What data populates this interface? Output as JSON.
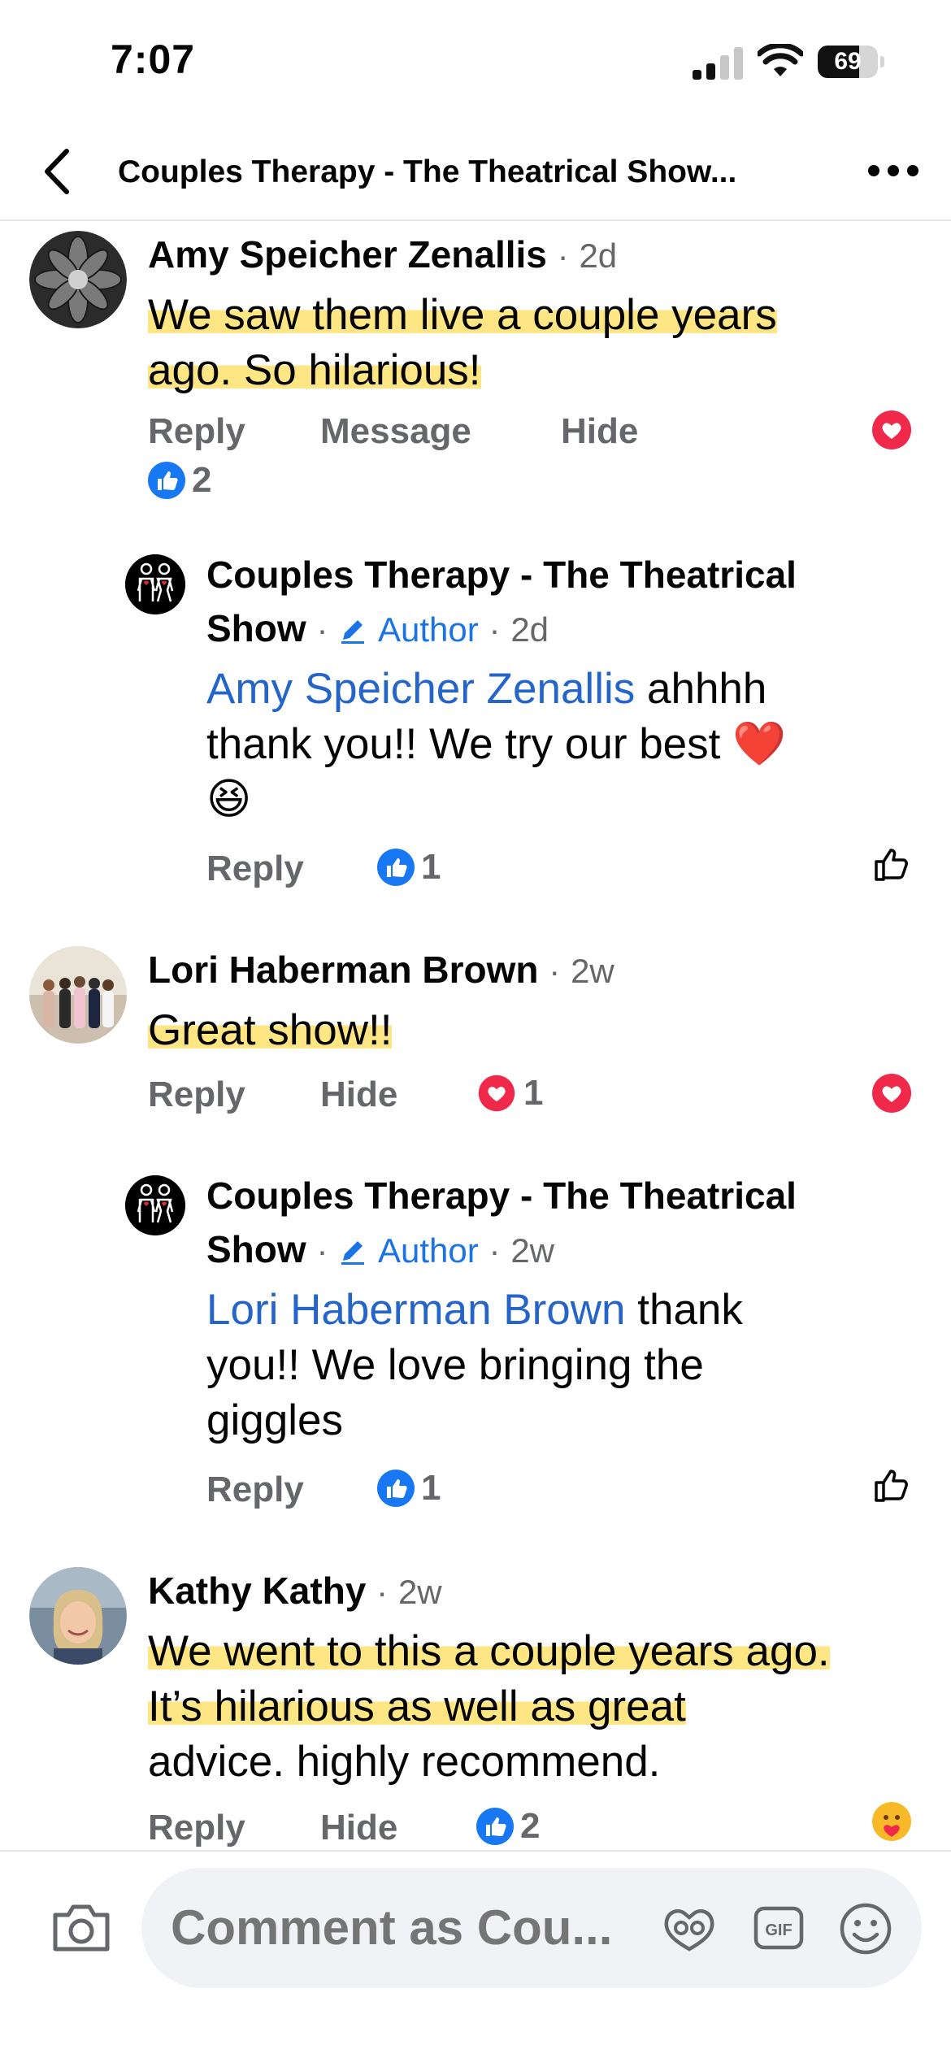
{
  "status_bar": {
    "time": "7:07",
    "battery": "69",
    "battery_level": 0.69
  },
  "header": {
    "title": "Couples Therapy - The Theatrical Show..."
  },
  "comments": [
    {
      "author": "Amy Speicher Zenallis",
      "time": "2d",
      "text_line1": "We saw them live a couple years",
      "text_line2": "ago.  So hilarious!",
      "actions": [
        "Reply",
        "Message",
        "Hide"
      ],
      "reaction_count": "2",
      "reaction_type": "like"
    },
    {
      "author_line1": "Couples Therapy - The Theatrical",
      "author_line2": "Show",
      "badge": "Author",
      "time": "2d",
      "mention": "Amy Speicher Zenallis",
      "text_rest": " ahhhh",
      "text_line2": "thank you!! We try our best",
      "emoji_heart": "❤️",
      "emoji_laugh": "😆",
      "actions": [
        "Reply"
      ],
      "reaction_count": "1",
      "reaction_type": "like"
    },
    {
      "author": "Lori Haberman Brown",
      "time": "2w",
      "text_line1": "Great show!!",
      "actions": [
        "Reply",
        "Hide"
      ],
      "reaction_count": "1",
      "reaction_type": "love"
    },
    {
      "author_line1": "Couples Therapy - The Theatrical",
      "author_line2": "Show",
      "badge": "Author",
      "time": "2w",
      "mention": "Lori Haberman Brown",
      "text_rest": " thank",
      "text_line2": "you!! We love bringing the",
      "text_line3": "giggles",
      "actions": [
        "Reply"
      ],
      "reaction_count": "1",
      "reaction_type": "like"
    },
    {
      "author": "Kathy Kathy",
      "time": "2w",
      "text_line1": "We went to this a couple years ago.",
      "text_line2": "It’s hilarious as well as great",
      "text_line3": "advice.  highly recommend.",
      "actions": [
        "Reply",
        "Hide"
      ],
      "reaction_count": "2",
      "reaction_type": "like"
    }
  ],
  "separator": "·",
  "composer": {
    "placeholder": "Comment as Cou...",
    "gif_label": "GIF"
  },
  "colors": {
    "like_blue": "#1877f2",
    "love_red": "#f0284a",
    "mention_blue": "#2564c9",
    "highlight": "#ffdd5a"
  }
}
